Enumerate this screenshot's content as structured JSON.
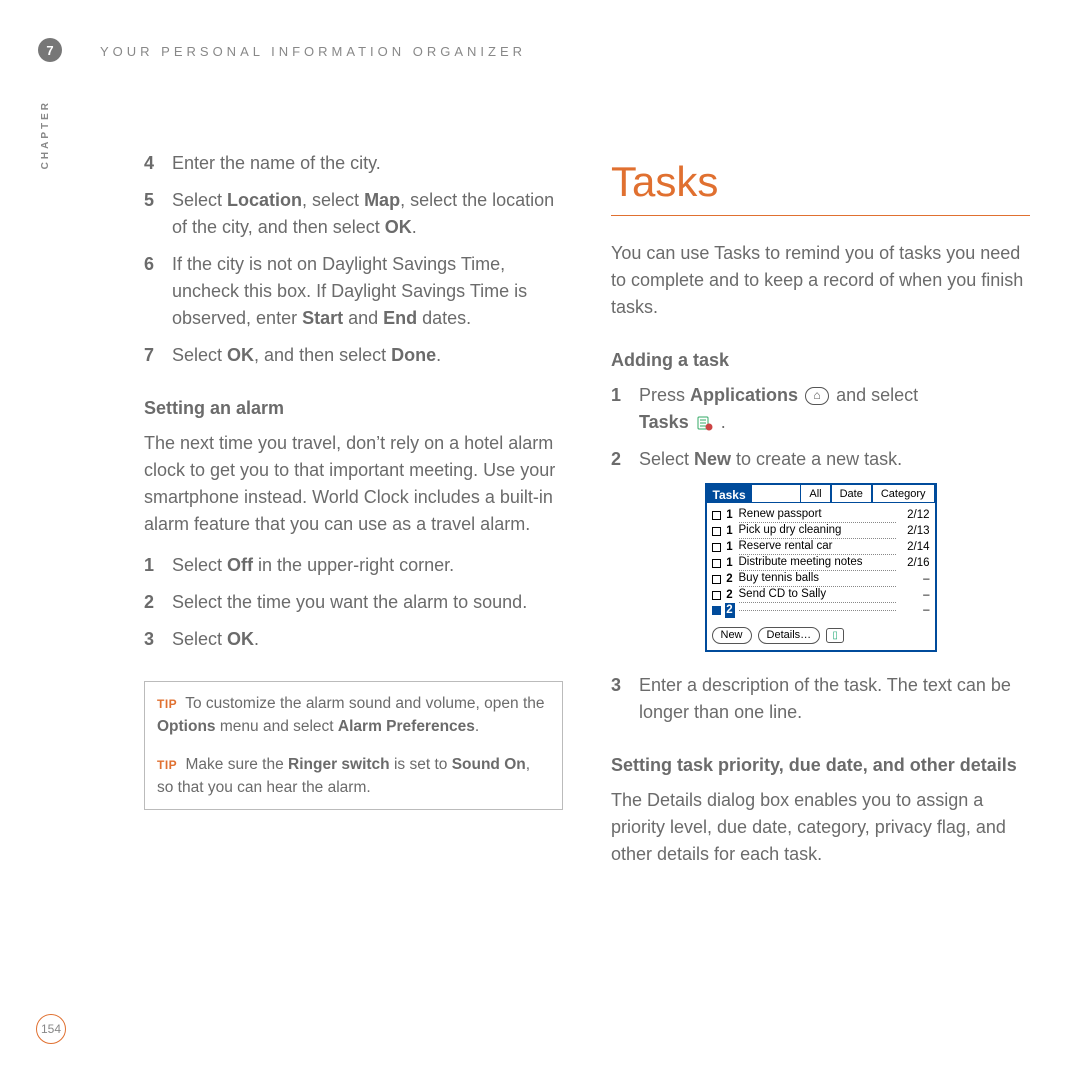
{
  "chapter": {
    "number": "7",
    "label": "CHAPTER",
    "running_head": "YOUR PERSONAL INFORMATION ORGANIZER"
  },
  "page_number": "154",
  "left": {
    "steps_a": [
      {
        "n": "4",
        "html": "Enter the name of the city."
      },
      {
        "n": "5",
        "html": "Select <b>Location</b>, select <b>Map</b>, select the location of the city, and then select <b>OK</b>."
      },
      {
        "n": "6",
        "html": "If the city is not on Daylight Savings Time, uncheck this box. If Daylight Savings Time is observed, enter <b>Start</b> and <b>End</b> dates."
      },
      {
        "n": "7",
        "html": "Select <b>OK</b>, and then select <b>Done</b>."
      }
    ],
    "alarm_heading": "Setting an alarm",
    "alarm_intro": "The next time you travel, don’t rely on a hotel alarm clock to get you to that important meeting. Use your smartphone instead. World Clock includes a built-in alarm feature that you can use as a travel alarm.",
    "steps_b": [
      {
        "n": "1",
        "html": "Select <b>Off</b> in the upper-right corner."
      },
      {
        "n": "2",
        "html": "Select the time you want the alarm to sound."
      },
      {
        "n": "3",
        "html": "Select <b>OK</b>."
      }
    ],
    "tip_label": "TIP",
    "tip1": "To customize the alarm sound and volume, open the <b>Options</b> menu and select <b>Alarm Preferences</b>.",
    "tip2": "Make sure the <b>Ringer switch</b> is set to <b>Sound On</b>, so that you can hear the alarm."
  },
  "right": {
    "section_title": "Tasks",
    "intro": "You can use Tasks to remind you of tasks you need to complete and to keep a record of when you finish tasks.",
    "adding_heading": "Adding a task",
    "step1_pre": "Press ",
    "step1_applications": "Applications",
    "step1_mid": " and select ",
    "step1_tasks": "Tasks",
    "step1_post": " .",
    "step2": "Select <b>New</b> to create a new task.",
    "step3": "Enter a description of the task. The text can be longer than one line.",
    "details_heading": "Setting task priority, due date, and other details",
    "details_body": "The Details dialog box enables you to assign a priority level, due date, category, privacy flag, and other details for each task.",
    "screen": {
      "title": "Tasks",
      "filter_all": "All",
      "filter_date": "Date",
      "filter_category": "Category",
      "rows": [
        {
          "prio": "1",
          "desc": "Renew passport",
          "date": "2/12"
        },
        {
          "prio": "1",
          "desc": "Pick up dry cleaning",
          "date": "2/13"
        },
        {
          "prio": "1",
          "desc": "Reserve rental car",
          "date": "2/14"
        },
        {
          "prio": "1",
          "desc": "Distribute meeting notes",
          "date": "2/16"
        },
        {
          "prio": "2",
          "desc": "Buy tennis balls",
          "date": "–"
        },
        {
          "prio": "2",
          "desc": "Send CD to Sally",
          "date": "–"
        },
        {
          "prio": "2",
          "desc": "",
          "date": "–",
          "selected": true
        }
      ],
      "btn_new": "New",
      "btn_details": "Details…"
    }
  }
}
